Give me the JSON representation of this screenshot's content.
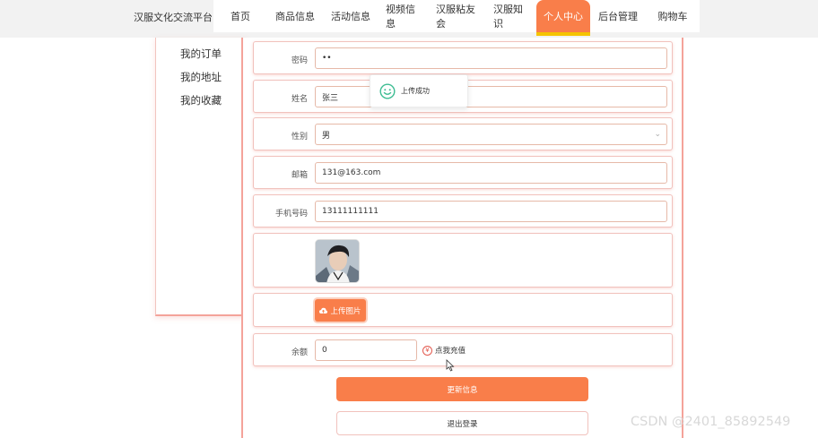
{
  "header": {
    "brand": "汉服文化交流平台",
    "nav": [
      {
        "label": "首页"
      },
      {
        "label": "商品信息"
      },
      {
        "label": "活动信息"
      },
      {
        "label": "视频信息"
      },
      {
        "label": "汉服粘友会"
      },
      {
        "label": "汉服知识"
      },
      {
        "label": "个人中心",
        "active": true
      },
      {
        "label": "后台管理"
      },
      {
        "label": "购物车"
      }
    ]
  },
  "sidebar": {
    "items": [
      {
        "label": "我的订单"
      },
      {
        "label": "我的地址"
      },
      {
        "label": "我的收藏"
      }
    ]
  },
  "form": {
    "password": {
      "label": "密码",
      "value": "••"
    },
    "name": {
      "label": "姓名",
      "value": "张三"
    },
    "gender": {
      "label": "性别",
      "value": "男"
    },
    "email": {
      "label": "邮箱",
      "value": "131@163.com"
    },
    "phone": {
      "label": "手机号码",
      "value": "13111111111"
    },
    "upload_label": "上传图片",
    "balance": {
      "label": "余额",
      "value": "0"
    },
    "recharge_label": "点我充值"
  },
  "actions": {
    "update_label": "更新信息",
    "logout_label": "退出登录"
  },
  "toast": {
    "message": "上传成功"
  },
  "watermark": "CSDN @2401_85892549",
  "colors": {
    "accent": "#f97e4a",
    "active_underline": "#f5c400",
    "border_pink": "#f4a39a",
    "success": "#3ebd93"
  }
}
